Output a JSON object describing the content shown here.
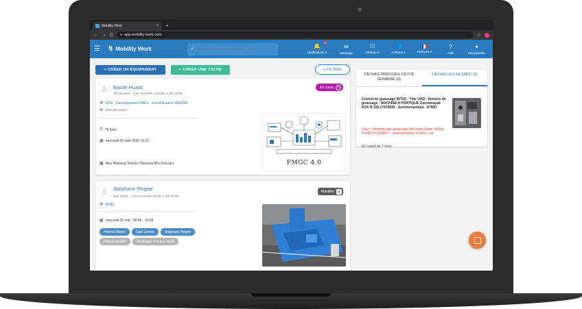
{
  "browser": {
    "tab_title": "Mobility Work",
    "tab_close": "×",
    "new_tab": "+",
    "url": "app.mobility-work.com",
    "back": "←",
    "forward": "→",
    "reload": "C",
    "lock": "●",
    "star": "☆"
  },
  "appbar": {
    "menu": "☰",
    "logo_mark": "↯",
    "logo_text": "Mobility Work",
    "search_placeholder": "Rechercher un équipement, une...",
    "search_icon": "⌕",
    "nav": [
      {
        "label": "Notifications ▾",
        "icon": "🔔",
        "badge": "9"
      },
      {
        "label": "Message",
        "icon": "✉"
      },
      {
        "label": "Réseau ▾",
        "icon": "⛫"
      },
      {
        "label": "Anthony ▾",
        "icon": "👥"
      },
      {
        "label": "Français ▾"
      },
      {
        "label": "Aide",
        "icon": "?"
      },
      {
        "label": "Nouveautés",
        "icon": "✦"
      }
    ],
    "flag_colors": [
      "#2150a8",
      "#ffffff",
      "#e03a3e"
    ]
  },
  "actions": {
    "create_equipment": "CRÉER UN ÉQUIPEMENT",
    "create_task": "CRÉER UNE TÂCHE",
    "filters": "FILTRES",
    "plus": "+",
    "filter_icon": "≡"
  },
  "cards": [
    {
      "name": "Basile Huard",
      "subtitle": "36 minutes - Une nouvelle activité a été créée",
      "status": "En cours",
      "site": "SITE - Développement MES - Immobilisation 9000268",
      "project": "Suivi de projet",
      "duration": "7h 0mn.",
      "date": "mercredi 29 avril 2020 16:13",
      "planning": "Mes Planning Service Planning Mes Encours",
      "image_caption": "FMGC 4.0"
    },
    {
      "name": "Stephane Peigne",
      "subtitle": "une heure - Une nouvelle tâche a été créée",
      "status": "Planifiée",
      "site": "MI381",
      "date": "mercredi 05 mai · 00:00 - 23:59",
      "chips_blue": [
        "Pierrick Minier",
        "Gael Lemee",
        "Stephane Peigne"
      ],
      "chips_grey": [
        "Plaque Modèle",
        "Modelage Travaux neufs"
      ]
    }
  ],
  "sidebar": {
    "tabs": [
      "TÂCHES PRÉVUES CETTE SEMAINE (0)",
      "TÂCHES EN RETARD (1)"
    ],
    "item_title": "Central de graissage INTZA - Tête UAD - Armoire de graissage - MACHINE A PORTIQUE Correanayak FOX M 155 n°670026 - Euromecanique - N°900",
    "item_detail": "Suivi - Remplissage graissage tête huile kluber HySyn FG68 PT0214067 - consommation 15 litres / an",
    "item_late": "En retard de 7 mois"
  }
}
